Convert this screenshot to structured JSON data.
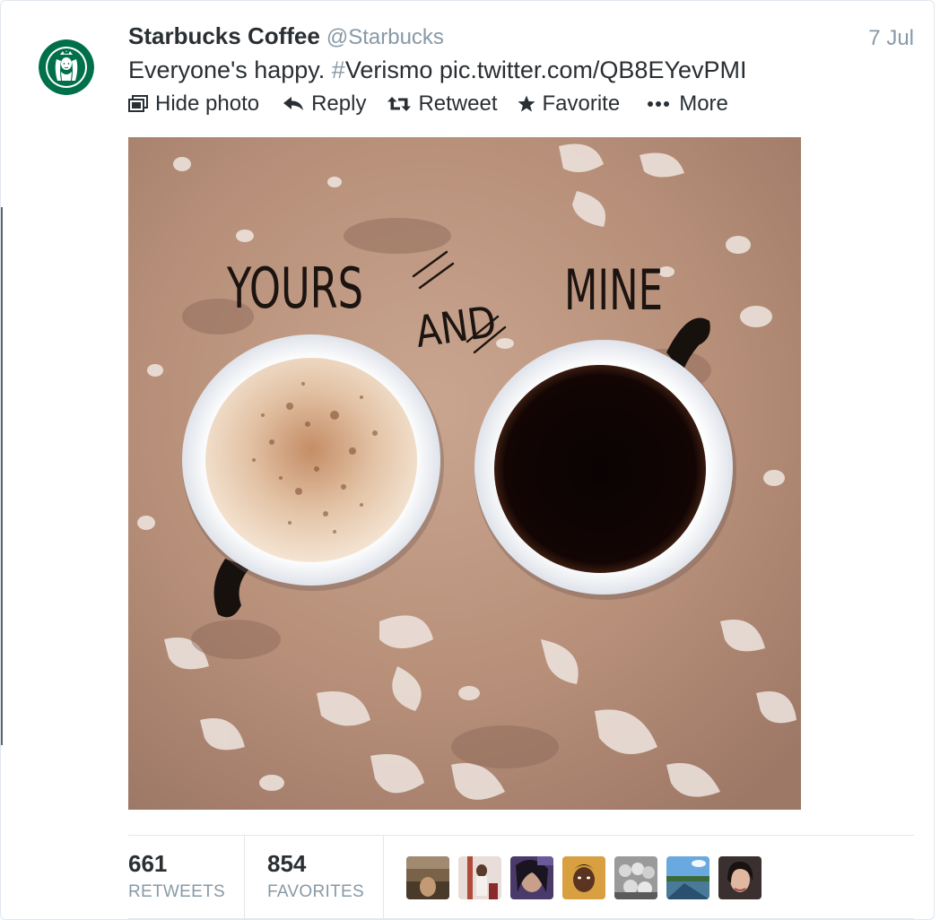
{
  "tweet": {
    "fullname": "Starbucks Coffee",
    "username": "@Starbucks",
    "timestamp": "7 Jul",
    "text_lead": "Everyone's happy. ",
    "hash_symbol": "#",
    "hashtag": "Verismo",
    "link": " pic.twitter.com/QB8EYevPMI",
    "avatar_icon": "starbucks-siren-logo"
  },
  "actions": [
    {
      "label": "Hide photo",
      "icon": "photo-icon"
    },
    {
      "label": "Reply",
      "icon": "reply-arrow-icon"
    },
    {
      "label": "Retweet",
      "icon": "retweet-icon"
    },
    {
      "label": "Favorite",
      "icon": "star-icon"
    },
    {
      "label": "More",
      "icon": "ellipsis-icon"
    }
  ],
  "media": {
    "caption_left": "YOURS",
    "caption_middle": "AND",
    "caption_right": "MINE"
  },
  "stats": {
    "retweets_count": "661",
    "retweets_label": "RETWEETS",
    "favorites_count": "854",
    "favorites_label": "FAVORITES"
  },
  "favoriters_count": 7,
  "colors": {
    "starbucks_green": "#00704a",
    "text": "#292f33",
    "muted": "#8899a6",
    "border": "#e1e8ed"
  }
}
